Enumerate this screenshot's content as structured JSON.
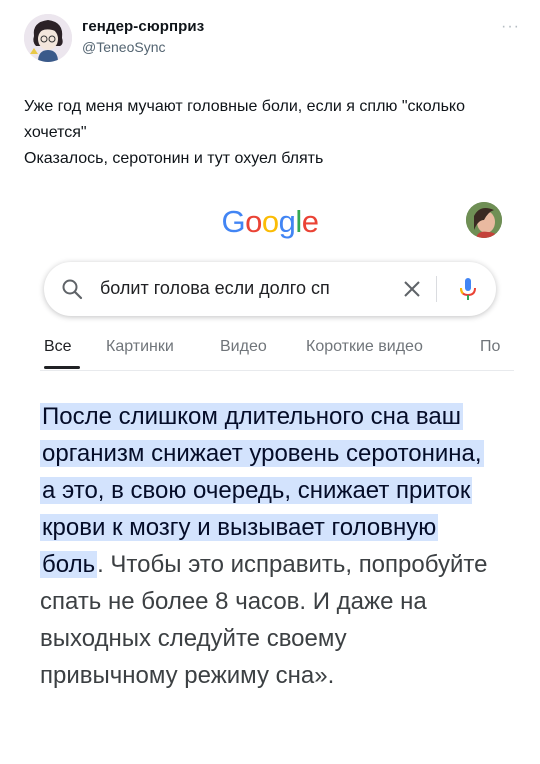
{
  "tweet": {
    "author_name": "гендер-сюрприз",
    "author_handle": "@TeneoSync",
    "more_icon": "more-icon",
    "text_line1": "Уже год меня мучают головные боли, если я сплю \"сколько хочется\"",
    "text_line2": "Оказалось, серотонин и тут охуел блять"
  },
  "google": {
    "logo_letters": [
      "G",
      "o",
      "o",
      "g",
      "l",
      "e"
    ],
    "logo_colors": [
      "#4285f4",
      "#ea4335",
      "#fbbc05",
      "#4285f4",
      "#34a853",
      "#ea4335"
    ],
    "search": {
      "query": "болит голова если долго сп",
      "search_icon": "search-icon",
      "clear_icon": "close-icon",
      "mic_icon": "mic-icon"
    },
    "tabs": [
      "Все",
      "Картинки",
      "Видео",
      "Короткие видео",
      "По"
    ],
    "active_tab": "Все",
    "answer_highlighted": "После слишком длительного сна ваш организм снижает уровень серотонина, а это, в свою очередь, снижает приток крови к мозгу и вызывает головную боль",
    "answer_rest": ". Чтобы это исправить, попробуйте спать не более 8 часов. И даже на выходных следуйте своему привычному режиму сна».",
    "highlight_color": "#d3e3fd"
  }
}
